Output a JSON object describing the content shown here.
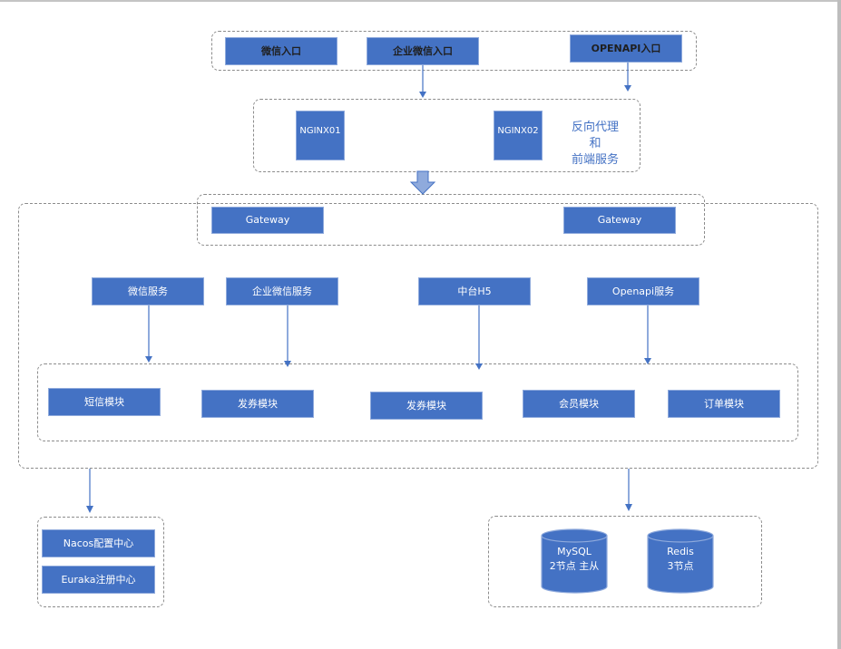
{
  "entry_layer": {
    "items": [
      {
        "label": "微信入口"
      },
      {
        "label": "企业微信入口"
      },
      {
        "label": "OPENAPI入口"
      }
    ]
  },
  "proxy_layer": {
    "nodes": [
      {
        "label": "NGINX01"
      },
      {
        "label": "NGINX02"
      }
    ],
    "description_lines": [
      "反向代理",
      "和",
      "前端服务"
    ]
  },
  "gateway_layer": {
    "nodes": [
      {
        "label": "Gateway"
      },
      {
        "label": "Gateway"
      }
    ]
  },
  "service_layer": {
    "services": [
      {
        "label": "微信服务"
      },
      {
        "label": "企业微信服务"
      },
      {
        "label": "中台H5"
      },
      {
        "label": "Openapi服务"
      }
    ]
  },
  "module_layer": {
    "modules": [
      {
        "label": "短信模块"
      },
      {
        "label": "发券模块"
      },
      {
        "label": "发券模块"
      },
      {
        "label": "会员模块"
      },
      {
        "label": "订单模块"
      }
    ]
  },
  "registry_layer": {
    "items": [
      {
        "label": "Nacos配置中心"
      },
      {
        "label": "Euraka注册中心"
      }
    ]
  },
  "storage_layer": {
    "databases": [
      {
        "name": "MySQL",
        "detail": "2节点 主从"
      },
      {
        "name": "Redis",
        "detail": "3节点"
      }
    ]
  },
  "colors": {
    "box_fill": "#4472C4",
    "box_border": "#8FAADC",
    "group_border": "#8C8C8C",
    "arrow": "#4472C4",
    "block_arrow_fill": "#8FAADC"
  }
}
